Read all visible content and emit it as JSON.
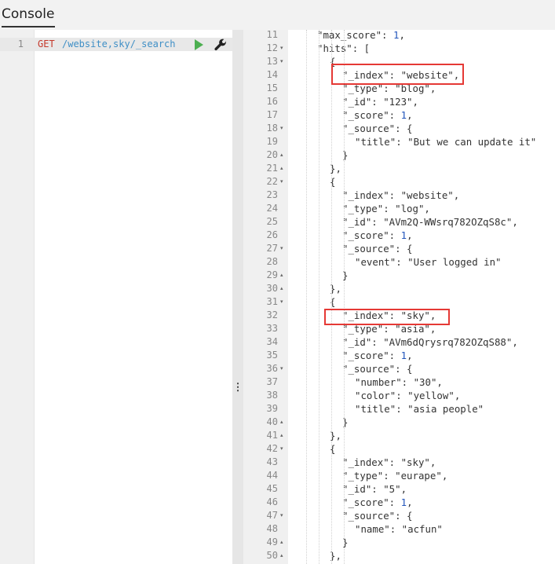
{
  "tab": {
    "label": "Console"
  },
  "request": {
    "line_number": "1",
    "method": "GET",
    "url": "/website,sky/_search"
  },
  "response": {
    "lines": [
      {
        "n": "11",
        "indent": 2,
        "fold": "",
        "t": "\"max_score\": 1,"
      },
      {
        "n": "12",
        "indent": 2,
        "fold": "▾",
        "t": "\"hits\": ["
      },
      {
        "n": "13",
        "indent": 3,
        "fold": "▾",
        "t": "{"
      },
      {
        "n": "14",
        "indent": 4,
        "fold": "",
        "t": "\"_index\": \"website\","
      },
      {
        "n": "15",
        "indent": 4,
        "fold": "",
        "t": "\"_type\": \"blog\","
      },
      {
        "n": "16",
        "indent": 4,
        "fold": "",
        "t": "\"_id\": \"123\","
      },
      {
        "n": "17",
        "indent": 4,
        "fold": "",
        "t": "\"_score\": 1,"
      },
      {
        "n": "18",
        "indent": 4,
        "fold": "▾",
        "t": "\"_source\": {"
      },
      {
        "n": "19",
        "indent": 5,
        "fold": "",
        "t": "\"title\": \"But we can update it\""
      },
      {
        "n": "20",
        "indent": 4,
        "fold": "▴",
        "t": "}"
      },
      {
        "n": "21",
        "indent": 3,
        "fold": "▴",
        "t": "},"
      },
      {
        "n": "22",
        "indent": 3,
        "fold": "▾",
        "t": "{"
      },
      {
        "n": "23",
        "indent": 4,
        "fold": "",
        "t": "\"_index\": \"website\","
      },
      {
        "n": "24",
        "indent": 4,
        "fold": "",
        "t": "\"_type\": \"log\","
      },
      {
        "n": "25",
        "indent": 4,
        "fold": "",
        "t": "\"_id\": \"AVm2Q-WWsrq782OZqS8c\","
      },
      {
        "n": "26",
        "indent": 4,
        "fold": "",
        "t": "\"_score\": 1,"
      },
      {
        "n": "27",
        "indent": 4,
        "fold": "▾",
        "t": "\"_source\": {"
      },
      {
        "n": "28",
        "indent": 5,
        "fold": "",
        "t": "\"event\": \"User logged in\""
      },
      {
        "n": "29",
        "indent": 4,
        "fold": "▴",
        "t": "}"
      },
      {
        "n": "30",
        "indent": 3,
        "fold": "▴",
        "t": "},"
      },
      {
        "n": "31",
        "indent": 3,
        "fold": "▾",
        "t": "{"
      },
      {
        "n": "32",
        "indent": 4,
        "fold": "",
        "t": "\"_index\": \"sky\","
      },
      {
        "n": "33",
        "indent": 4,
        "fold": "",
        "t": "\"_type\": \"asia\","
      },
      {
        "n": "34",
        "indent": 4,
        "fold": "",
        "t": "\"_id\": \"AVm6dQrysrq782OZqS88\","
      },
      {
        "n": "35",
        "indent": 4,
        "fold": "",
        "t": "\"_score\": 1,"
      },
      {
        "n": "36",
        "indent": 4,
        "fold": "▾",
        "t": "\"_source\": {"
      },
      {
        "n": "37",
        "indent": 5,
        "fold": "",
        "t": "\"number\": \"30\","
      },
      {
        "n": "38",
        "indent": 5,
        "fold": "",
        "t": "\"color\": \"yellow\","
      },
      {
        "n": "39",
        "indent": 5,
        "fold": "",
        "t": "\"title\": \"asia people\""
      },
      {
        "n": "40",
        "indent": 4,
        "fold": "▴",
        "t": "}"
      },
      {
        "n": "41",
        "indent": 3,
        "fold": "▴",
        "t": "},"
      },
      {
        "n": "42",
        "indent": 3,
        "fold": "▾",
        "t": "{"
      },
      {
        "n": "43",
        "indent": 4,
        "fold": "",
        "t": "\"_index\": \"sky\","
      },
      {
        "n": "44",
        "indent": 4,
        "fold": "",
        "t": "\"_type\": \"eurape\","
      },
      {
        "n": "45",
        "indent": 4,
        "fold": "",
        "t": "\"_id\": \"5\","
      },
      {
        "n": "46",
        "indent": 4,
        "fold": "",
        "t": "\"_score\": 1,"
      },
      {
        "n": "47",
        "indent": 4,
        "fold": "▾",
        "t": "\"_source\": {"
      },
      {
        "n": "48",
        "indent": 5,
        "fold": "",
        "t": "\"name\": \"acfun\""
      },
      {
        "n": "49",
        "indent": 4,
        "fold": "▴",
        "t": "}"
      },
      {
        "n": "50",
        "indent": 3,
        "fold": "▴",
        "t": "},"
      }
    ]
  },
  "icons": {
    "run": "play-icon",
    "settings": "wrench-icon",
    "resize": "drag-handle-icon"
  },
  "colors": {
    "highlight": "#e53935",
    "method": "#c5392b",
    "url": "#3f8fc6",
    "run": "#4caf50"
  }
}
